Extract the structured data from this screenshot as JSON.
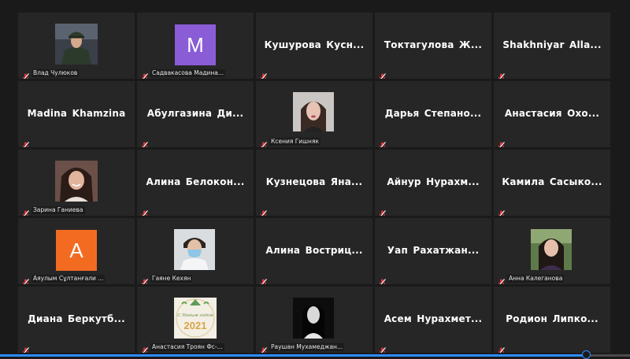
{
  "participants": [
    {
      "id": "p1",
      "type": "photo",
      "photo": "portrait-uniform",
      "label": "Влад Чулюков"
    },
    {
      "id": "p2",
      "type": "letter",
      "letter": "M",
      "color": "#8a5cd6",
      "label": "Садвакасова Мадина..."
    },
    {
      "id": "p3",
      "type": "name",
      "name": "Кушурова  Кусн..."
    },
    {
      "id": "p4",
      "type": "name",
      "name": "Токтагулова  Ж..."
    },
    {
      "id": "p5",
      "type": "name",
      "name": "Shakhniyar  Alla..."
    },
    {
      "id": "p6",
      "type": "name",
      "name": "Madina Khamzina"
    },
    {
      "id": "p7",
      "type": "name",
      "name": "Абулгазина  Ди..."
    },
    {
      "id": "p8",
      "type": "photo",
      "photo": "portrait-girl-dark",
      "label": "Ксения Гишняк"
    },
    {
      "id": "p9",
      "type": "name",
      "name": "Дарья  Степано..."
    },
    {
      "id": "p10",
      "type": "name",
      "name": "Анастасия  Охо..."
    },
    {
      "id": "p11",
      "type": "photo",
      "photo": "portrait-girl-smile",
      "label": "Зарина Ганиева"
    },
    {
      "id": "p12",
      "type": "name",
      "name": "Алина  Белокон..."
    },
    {
      "id": "p13",
      "type": "name",
      "name": "Кузнецова  Яна..."
    },
    {
      "id": "p14",
      "type": "name",
      "name": "Айнур  Нурахм..."
    },
    {
      "id": "p15",
      "type": "name",
      "name": "Камила  Сасыко..."
    },
    {
      "id": "p16",
      "type": "letter",
      "letter": "A",
      "color": "#f26b21",
      "label": "Аяулым Сұлтанғали ..."
    },
    {
      "id": "p17",
      "type": "photo",
      "photo": "portrait-mask",
      "label": "Гаяне Кехян"
    },
    {
      "id": "p18",
      "type": "name",
      "name": "Алина  Востриц..."
    },
    {
      "id": "p19",
      "type": "name",
      "name": "Уап  Рахатжан..."
    },
    {
      "id": "p20",
      "type": "photo",
      "photo": "portrait-girl-outdoor",
      "label": "Анна Калеганова"
    },
    {
      "id": "p21",
      "type": "name",
      "name": "Диана  Беркутб..."
    },
    {
      "id": "p22",
      "type": "photo",
      "photo": "new-year-card",
      "label": "Анастасия Троян Фс-...",
      "card_line1": "С Новым годом",
      "card_year": "2021"
    },
    {
      "id": "p23",
      "type": "photo",
      "photo": "portrait-bw",
      "label": "Раушан Мухамеджан..."
    },
    {
      "id": "p24",
      "type": "name",
      "name": "Асем  Нурахмет..."
    },
    {
      "id": "p25",
      "type": "name",
      "name": "Родион  Липко..."
    }
  ],
  "icons": {
    "mic": "muted-microphone-icon"
  },
  "colors": {
    "background": "#1a1a1a",
    "tile": "#262626",
    "muted": "#e0333a",
    "progress": "#2d8cff"
  },
  "progress": {
    "value": 0.93
  }
}
